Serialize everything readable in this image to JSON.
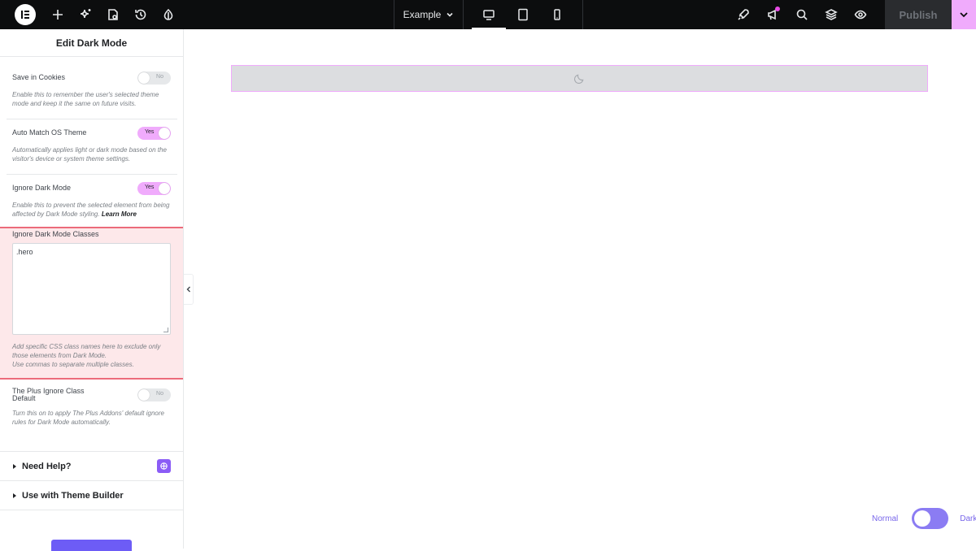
{
  "topbar": {
    "tools": [
      {
        "icon": "elementor-logo-icon"
      },
      {
        "icon": "add-icon"
      },
      {
        "icon": "ai-sparkle-icon"
      },
      {
        "icon": "site-settings-icon"
      },
      {
        "icon": "history-icon"
      },
      {
        "icon": "theme-style-drop-icon"
      }
    ],
    "document_name": "Example",
    "devices": [
      {
        "icon": "desktop-icon",
        "active": true
      },
      {
        "icon": "tablet-icon",
        "active": false
      },
      {
        "icon": "mobile-icon",
        "active": false
      }
    ],
    "right_tools": [
      {
        "icon": "rocket-icon"
      },
      {
        "icon": "announcements-icon",
        "badge": true
      },
      {
        "icon": "search-icon"
      },
      {
        "icon": "layers-icon"
      },
      {
        "icon": "preview-eye-icon"
      }
    ],
    "publish_label": "Publish"
  },
  "panel": {
    "title": "Edit Dark Mode",
    "controls": {
      "save_cookies": {
        "label": "Save in Cookies",
        "value": "No",
        "description": "Enable this to remember the user's selected theme mode and keep it the same on future visits."
      },
      "auto_match": {
        "label": "Auto Match OS Theme",
        "value": "Yes",
        "description": "Automatically applies light or dark mode based on the visitor's device or system theme settings."
      },
      "ignore_dark": {
        "label": "Ignore Dark Mode",
        "value": "Yes",
        "description": "Enable this to prevent the selected element from being affected by Dark Mode styling.",
        "learn_more": "Learn More"
      },
      "ignore_classes": {
        "label": "Ignore Dark Mode Classes",
        "value": ".hero",
        "description_1": "Add specific CSS class names here to exclude only those elements from Dark Mode.",
        "description_2": "Use commas to separate multiple classes."
      },
      "plus_ignore": {
        "label_1": "The Plus Ignore Class",
        "label_2": "Default",
        "value": "No",
        "description": "Turn this on to apply The Plus Addons' default ignore rules for Dark Mode automatically."
      }
    },
    "sections": {
      "help": "Need Help?",
      "theme_builder": "Use with Theme Builder"
    }
  },
  "canvas": {
    "section_icon": "moon-icon",
    "mode_switch": {
      "normal_label": "Normal",
      "dark_label": "Dark",
      "state": "Normal"
    }
  },
  "colors": {
    "accent_pink": "#f0abfc",
    "highlight_border": "#ec6b7b",
    "toggle_purple": "#8b7cf3"
  }
}
